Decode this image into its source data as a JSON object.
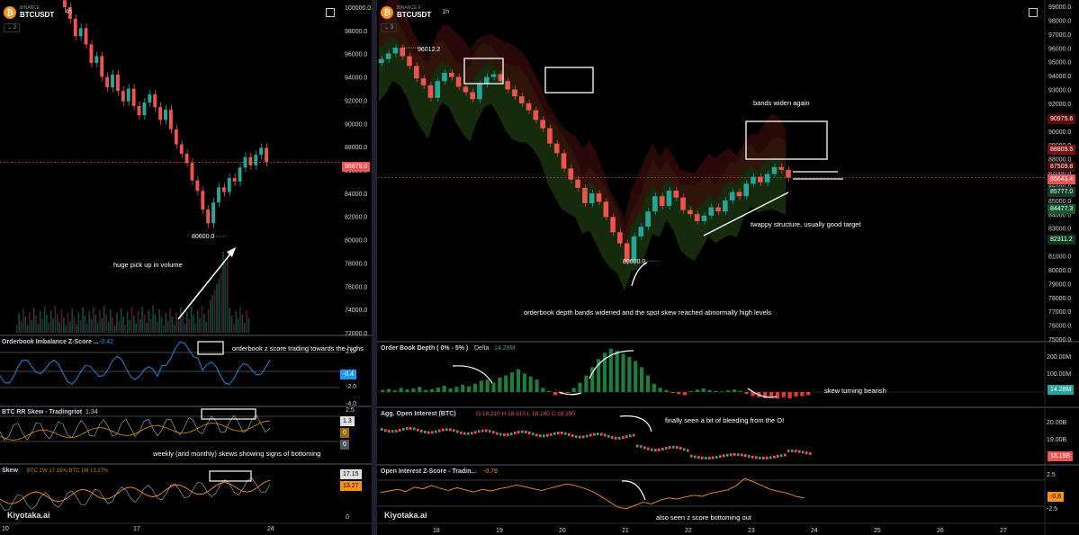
{
  "left": {
    "exchange": "BINANCE",
    "symbol": "BTCUSDT",
    "timeframe": "4h",
    "pane_count": "2",
    "price_axis": [
      "100000.0",
      "98000.0",
      "96000.0",
      "94000.0",
      "92000.0",
      "90000.0",
      "88000.0",
      "86000.0",
      "84000.0",
      "82000.0",
      "80000.0",
      "78000.0",
      "76000.0",
      "74000.0",
      "72000.0"
    ],
    "current_price": "86675.0",
    "low_label": "80600.0",
    "annotation_volume": "huge pick up in volume",
    "ind1": {
      "title": "Orderbook Imbalance Z-Score ...",
      "value": "-0.42",
      "axis": [
        "2.0",
        "-2.0",
        "-4.0"
      ],
      "tag": "-0.4",
      "annotation": "orderbook z score trading towards the highs"
    },
    "ind2": {
      "title": "BTC RR Skew - Tradingriot",
      "value": "1.34",
      "axis": [
        "2.5",
        "0"
      ],
      "tags": [
        "1.3",
        "0",
        "0"
      ],
      "annotation": "weekly (and monthly) skews showing signs of bottoming"
    },
    "ind3": {
      "title": "Skew",
      "legend": "BTC 1W 17.15%  BTC 1M 13.27%",
      "axis": [
        "0"
      ],
      "tags": [
        "17.15",
        "13.27"
      ]
    },
    "x_axis": [
      "10",
      "17",
      "24"
    ],
    "watermark": "Kiyotaka.ai"
  },
  "right": {
    "exchange": "BINANCE.F",
    "symbol": "BTCUSDT",
    "timeframe": "1h",
    "pane_count": "3",
    "price_axis": [
      "99000.0",
      "98000.0",
      "97000.0",
      "96000.0",
      "95000.0",
      "94000.0",
      "93000.0",
      "92000.0",
      "91000.0",
      "90000.0",
      "89000.0",
      "88000.0",
      "87000.0",
      "86000.0",
      "85000.0",
      "84000.0",
      "83000.0",
      "82000.0",
      "81000.0",
      "80000.0",
      "79000.0",
      "78000.0",
      "77000.0",
      "76000.0",
      "75000.0"
    ],
    "price_tags": [
      "90975.6",
      "88809.5",
      "87509.8",
      "86643.4",
      "85777.0",
      "84477.3",
      "82311.2"
    ],
    "high_label": "96012.2",
    "low_label": "80600.0",
    "annotation_bands": "bands widen again",
    "annotation_structure": "twappy structure, usually good target",
    "annotation_depth": "orderbook depth bands widened and the spot skew reached abnormally high levels",
    "ind1": {
      "title": "Order Book Depth ( 0% - 5% )",
      "delta_label": "Delta",
      "delta_value": "14.28M",
      "axis": [
        "200.00M",
        "100.00M"
      ],
      "tag": "14.28M",
      "annotation": "skew turning bearish"
    },
    "ind2": {
      "title": "Agg. Open Interest (BTC)",
      "ohlc": "O 18.210  H 18.310  L 18.180  C 18.190",
      "axis": [
        "20.00B",
        "19.00B"
      ],
      "tag": "18.19B",
      "annotation": "finally seen a bit of bleeding from the OI"
    },
    "ind3": {
      "title": "Open Interest Z-Score - Tradin...",
      "value": "-0.79",
      "axis": [
        "2.5",
        "-2.5"
      ],
      "tag": "-0.8",
      "annotation": "also seen z score bottoming out"
    },
    "x_axis": [
      "18",
      "19",
      "20",
      "21",
      "22",
      "23",
      "24",
      "25",
      "26",
      "27"
    ],
    "watermark": "Kiyotaka.ai"
  },
  "colors": {
    "up": "#26a69a",
    "down": "#ef5350",
    "background": "#000000",
    "accent_blue": "#2196f3",
    "orange": "#f7931a"
  },
  "chart_data": [
    {
      "type": "candlestick",
      "title": "BTCUSDT 4h",
      "ylim": [
        72000,
        100000
      ],
      "close": [
        100000,
        99000,
        97500,
        98200,
        96800,
        95200,
        95800,
        94000,
        93100,
        94200,
        92800,
        91900,
        93000,
        91500,
        90700,
        91800,
        92500,
        91400,
        90300,
        91200,
        89500,
        88200,
        87400,
        86600,
        85100,
        84200,
        82600,
        81400,
        83200,
        84500,
        84100,
        85300,
        85000,
        86200,
        87100,
        86400,
        87300,
        87900,
        86700
      ]
    },
    {
      "type": "candlestick",
      "title": "BTCUSDT 1h",
      "ylim": [
        75000,
        99000
      ],
      "close": [
        95200,
        95600,
        96012,
        95400,
        94700,
        93800,
        93300,
        92400,
        93600,
        94200,
        93900,
        93200,
        92800,
        92300,
        93400,
        93900,
        94100,
        93600,
        93000,
        92500,
        92000,
        91500,
        90800,
        90200,
        89100,
        88400,
        87300,
        86500,
        85900,
        84800,
        85500,
        84900,
        83800,
        82700,
        81900,
        80600,
        82400,
        83100,
        84200,
        85300,
        84600,
        85700,
        85200,
        84300,
        84000,
        83500,
        83900,
        84500,
        84200,
        85000,
        85600,
        85300,
        86200,
        86700,
        86300,
        86900,
        87400,
        87200,
        86643
      ]
    },
    {
      "type": "bar",
      "title": "Order Book Depth ( 0% - 5% )",
      "values": [
        10,
        15,
        8,
        20,
        12,
        18,
        25,
        10,
        14,
        22,
        30,
        18,
        25,
        35,
        28,
        40,
        55,
        60,
        45,
        70,
        80,
        95,
        110,
        90,
        75,
        60,
        20,
        5,
        -15,
        -10,
        -5,
        20,
        45,
        80,
        120,
        160,
        190,
        210,
        200,
        185,
        170,
        150,
        120,
        80,
        40,
        20,
        10,
        -5,
        -10,
        -15,
        5,
        12,
        18,
        10,
        5,
        3,
        8,
        12,
        6,
        -8,
        -20,
        -25,
        -30,
        -28,
        -32,
        -25,
        -30,
        -22,
        -20,
        -15
      ]
    },
    {
      "type": "line",
      "title": "Open Interest Z-Score - Tradin...",
      "ylim": [
        -3,
        3
      ],
      "values": [
        0.2,
        0.5,
        0.8,
        0.4,
        1.2,
        0.9,
        1.5,
        1.0,
        0.6,
        1.1,
        0.7,
        0.3,
        0.8,
        0.5,
        0.9,
        1.2,
        1.6,
        1.3,
        0.9,
        0.6,
        1.0,
        1.4,
        1.8,
        1.5,
        1.0,
        0.4,
        -0.5,
        -1.5,
        -2.5,
        -2.8,
        -2.2,
        -1.6,
        -1.9,
        -1.2,
        -0.8,
        -1.0,
        -0.6,
        -0.3,
        -0.5,
        0.1,
        0.4,
        0.7,
        1.5,
        2.8,
        2.2,
        1.5,
        0.8,
        0.4,
        0.1,
        -0.5,
        -0.8
      ]
    }
  ]
}
